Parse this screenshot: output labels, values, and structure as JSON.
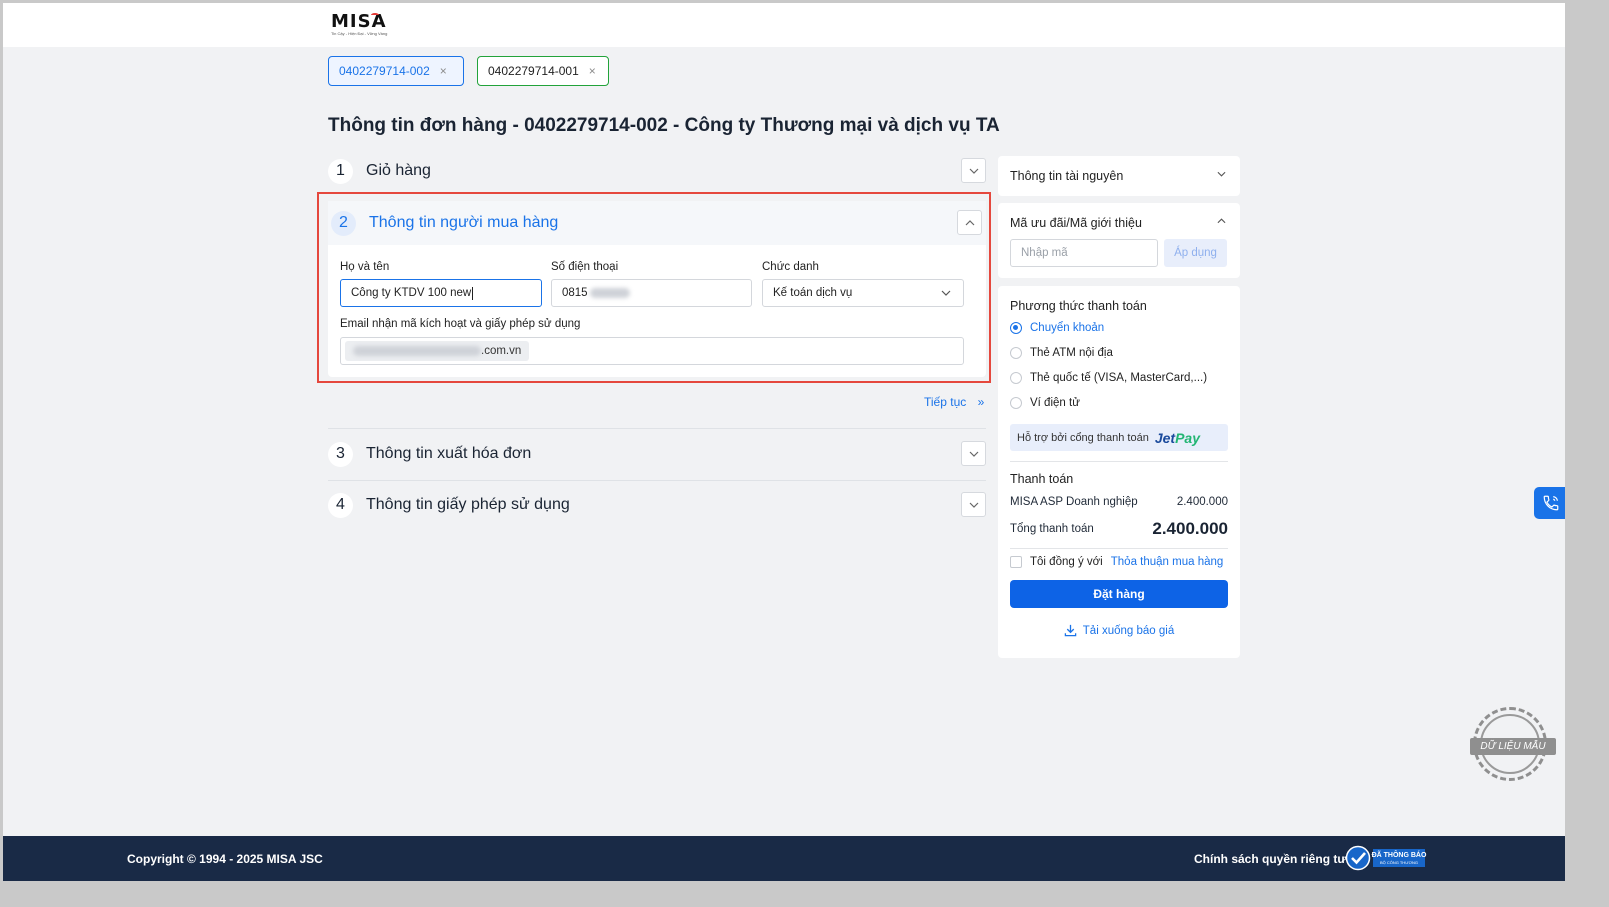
{
  "logo": {
    "text": "MISA",
    "tagline": "Tin Cậy - Hiện Đại - Vững Vàng"
  },
  "tabs": [
    {
      "label": "0402279714-002",
      "close": "×",
      "active": true
    },
    {
      "label": "0402279714-001",
      "close": "×",
      "active": false
    }
  ],
  "page_title": "Thông tin đơn hàng - 0402279714-002 - Công ty Thương mại và dịch vụ TA",
  "sections": [
    {
      "number": "1",
      "title": "Giỏ hàng"
    },
    {
      "number": "2",
      "title": "Thông tin người mua hàng"
    },
    {
      "number": "3",
      "title": "Thông tin xuất hóa đơn"
    },
    {
      "number": "4",
      "title": "Thông tin giấy phép sử dụng"
    }
  ],
  "buyer_form": {
    "name_label": "Họ và tên",
    "name_value": "Công ty KTDV 100 new",
    "phone_label": "Số điện thoại",
    "phone_value_prefix": "0815",
    "title_label": "Chức danh",
    "title_value": "Kế toán dịch vụ",
    "email_label": "Email nhận mã kích hoạt và giấy phép sử dụng",
    "email_value_suffix": ".com.vn"
  },
  "continue_label": "Tiếp tục",
  "continue_icon": "»",
  "sidebar": {
    "resource_title": "Thông tin tài nguyên",
    "promo_title": "Mã ưu đãi/Mã giới thiệu",
    "promo_placeholder": "Nhập mã",
    "apply_label": "Áp dụng",
    "payment_title": "Phương thức thanh toán",
    "payment_methods": [
      {
        "label": "Chuyển khoản",
        "selected": true
      },
      {
        "label": "Thẻ ATM nội địa",
        "selected": false
      },
      {
        "label": "Thẻ quốc tế (VISA, MasterCard,...)",
        "selected": false
      },
      {
        "label": "Ví điện tử",
        "selected": false
      }
    ],
    "jetpay_text": "Hỗ trợ bởi cổng thanh toán",
    "jetpay_brand_1": "Jet",
    "jetpay_brand_2": "Pay",
    "checkout_title": "Thanh toán",
    "line_item_name": "MISA ASP Doanh nghiệp",
    "line_item_price": "2.400.000",
    "total_label": "Tổng thanh toán",
    "total_value": "2.400.000",
    "agree_text": "Tôi đồng ý với",
    "agree_link": "Thỏa thuận mua hàng",
    "order_button": "Đặt hàng",
    "download_label": "Tải xuống báo giá"
  },
  "stamp_text": "DỮ LIỆU MẪU",
  "footer": {
    "copyright": "Copyright © 1994 - 2025 MISA JSC",
    "privacy": "Chính sách quyền riêng tư",
    "badge_line1": "ĐÃ THÔNG BÁO",
    "badge_line2": "BỘ CÔNG THƯƠNG"
  },
  "colors": {
    "accent": "#1a73e8",
    "highlight_border": "#e5483d",
    "footer_bg": "#192a46",
    "tab_other_border": "#22a33a"
  }
}
